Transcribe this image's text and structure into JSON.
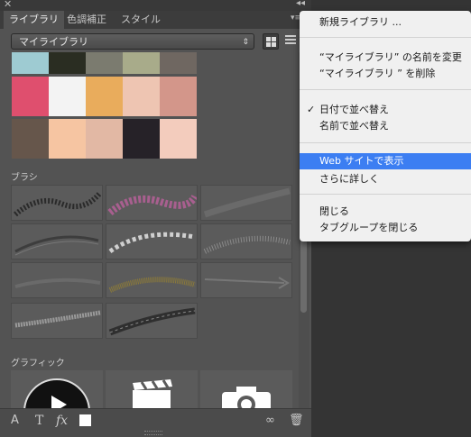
{
  "tabs": [
    "ライブラリ",
    "色調補正",
    "スタイル"
  ],
  "library_select": "マイライブラリ",
  "sections": {
    "brush": "ブラシ",
    "graphic": "グラフィック"
  },
  "colors": {
    "row1": [
      "#9ecbd2",
      "#2a2d22",
      "#7b7b6f",
      "#a8ab8a",
      "#6f6761"
    ],
    "row2": [
      "#df4f6e",
      "#f3f3f3",
      "#e9ac5c",
      "#eec5b2",
      "#d3968a"
    ],
    "row3": [
      "#66564b",
      "#f6c5a2",
      "#e2b8a4",
      "#262228",
      "#f3ccbd"
    ]
  },
  "icons": {
    "close": "close-icon",
    "collapse": "collapse-icon",
    "panel_menu": "panel-menu-icon",
    "grid_view": "grid-view-icon",
    "list_view": "list-view-icon",
    "add_character_style": "character-style-icon",
    "add_text": "text-icon",
    "add_layer_style": "fx-icon",
    "add_color": "color-swatch-icon",
    "sync": "creative-cloud-sync-icon",
    "delete": "trash-icon"
  },
  "bottom_glyphs": {
    "text": "T",
    "fx": "fx"
  },
  "menu": {
    "items": [
      {
        "label": "新規ライブラリ ..."
      },
      {
        "label": "“マイライブラリ” の名前を変更"
      },
      {
        "label": "“マイライブラリ ” を削除"
      },
      {
        "label": "日付で並べ替え",
        "checked": true
      },
      {
        "label": "名前で並べ替え"
      },
      {
        "label": "Web サイトで表示",
        "highlighted": true
      },
      {
        "label": "さらに詳しく"
      },
      {
        "label": "閉じる"
      },
      {
        "label": "タブグループを閉じる"
      }
    ],
    "checkmark": "✓",
    "highlight_color": "#3c7ef2"
  }
}
